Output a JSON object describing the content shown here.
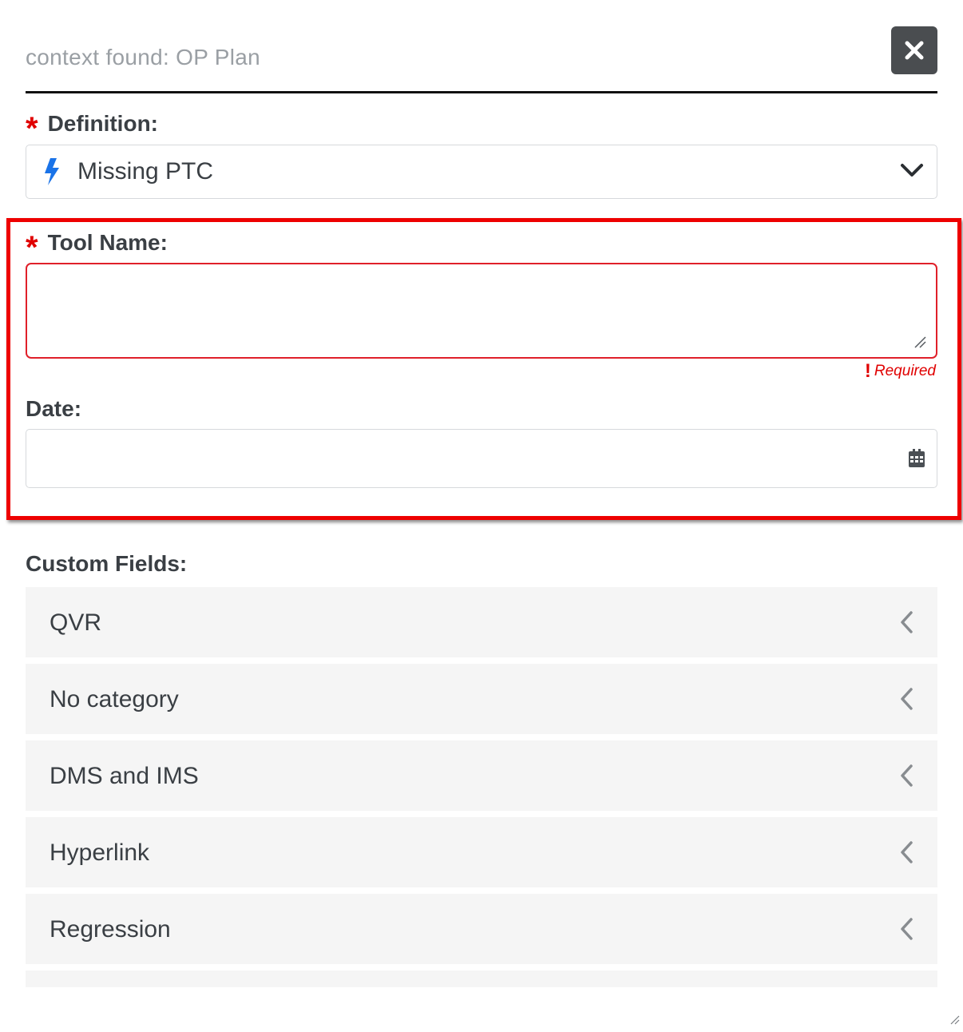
{
  "header": {
    "context_text": "context found: OP Plan",
    "close_label": "×"
  },
  "definition": {
    "required_mark": "*",
    "label": "Definition:",
    "selected_value": "Missing PTC"
  },
  "tool_name": {
    "required_mark": "*",
    "label": "Tool Name:",
    "value": "",
    "error_icon": "!",
    "error_text": "Required"
  },
  "date": {
    "label": "Date:",
    "value": ""
  },
  "custom_fields": {
    "label": "Custom Fields:",
    "items": [
      {
        "label": "QVR"
      },
      {
        "label": "No category"
      },
      {
        "label": "DMS and IMS"
      },
      {
        "label": "Hyperlink"
      },
      {
        "label": "Regression"
      }
    ]
  },
  "colors": {
    "required": "#e00000",
    "highlight_border": "#ee0000",
    "close_button_bg": "#4a4d50",
    "bolt_icon": "#1a73e8",
    "accordion_bg": "#f5f5f5"
  },
  "icons": {
    "close": "close-icon",
    "definition_type": "lightning-bolt-icon",
    "dropdown": "chevron-down-icon",
    "textarea_resize": "resize-grip-icon",
    "date_picker": "calendar-icon",
    "accordion": "chevron-left-icon"
  }
}
